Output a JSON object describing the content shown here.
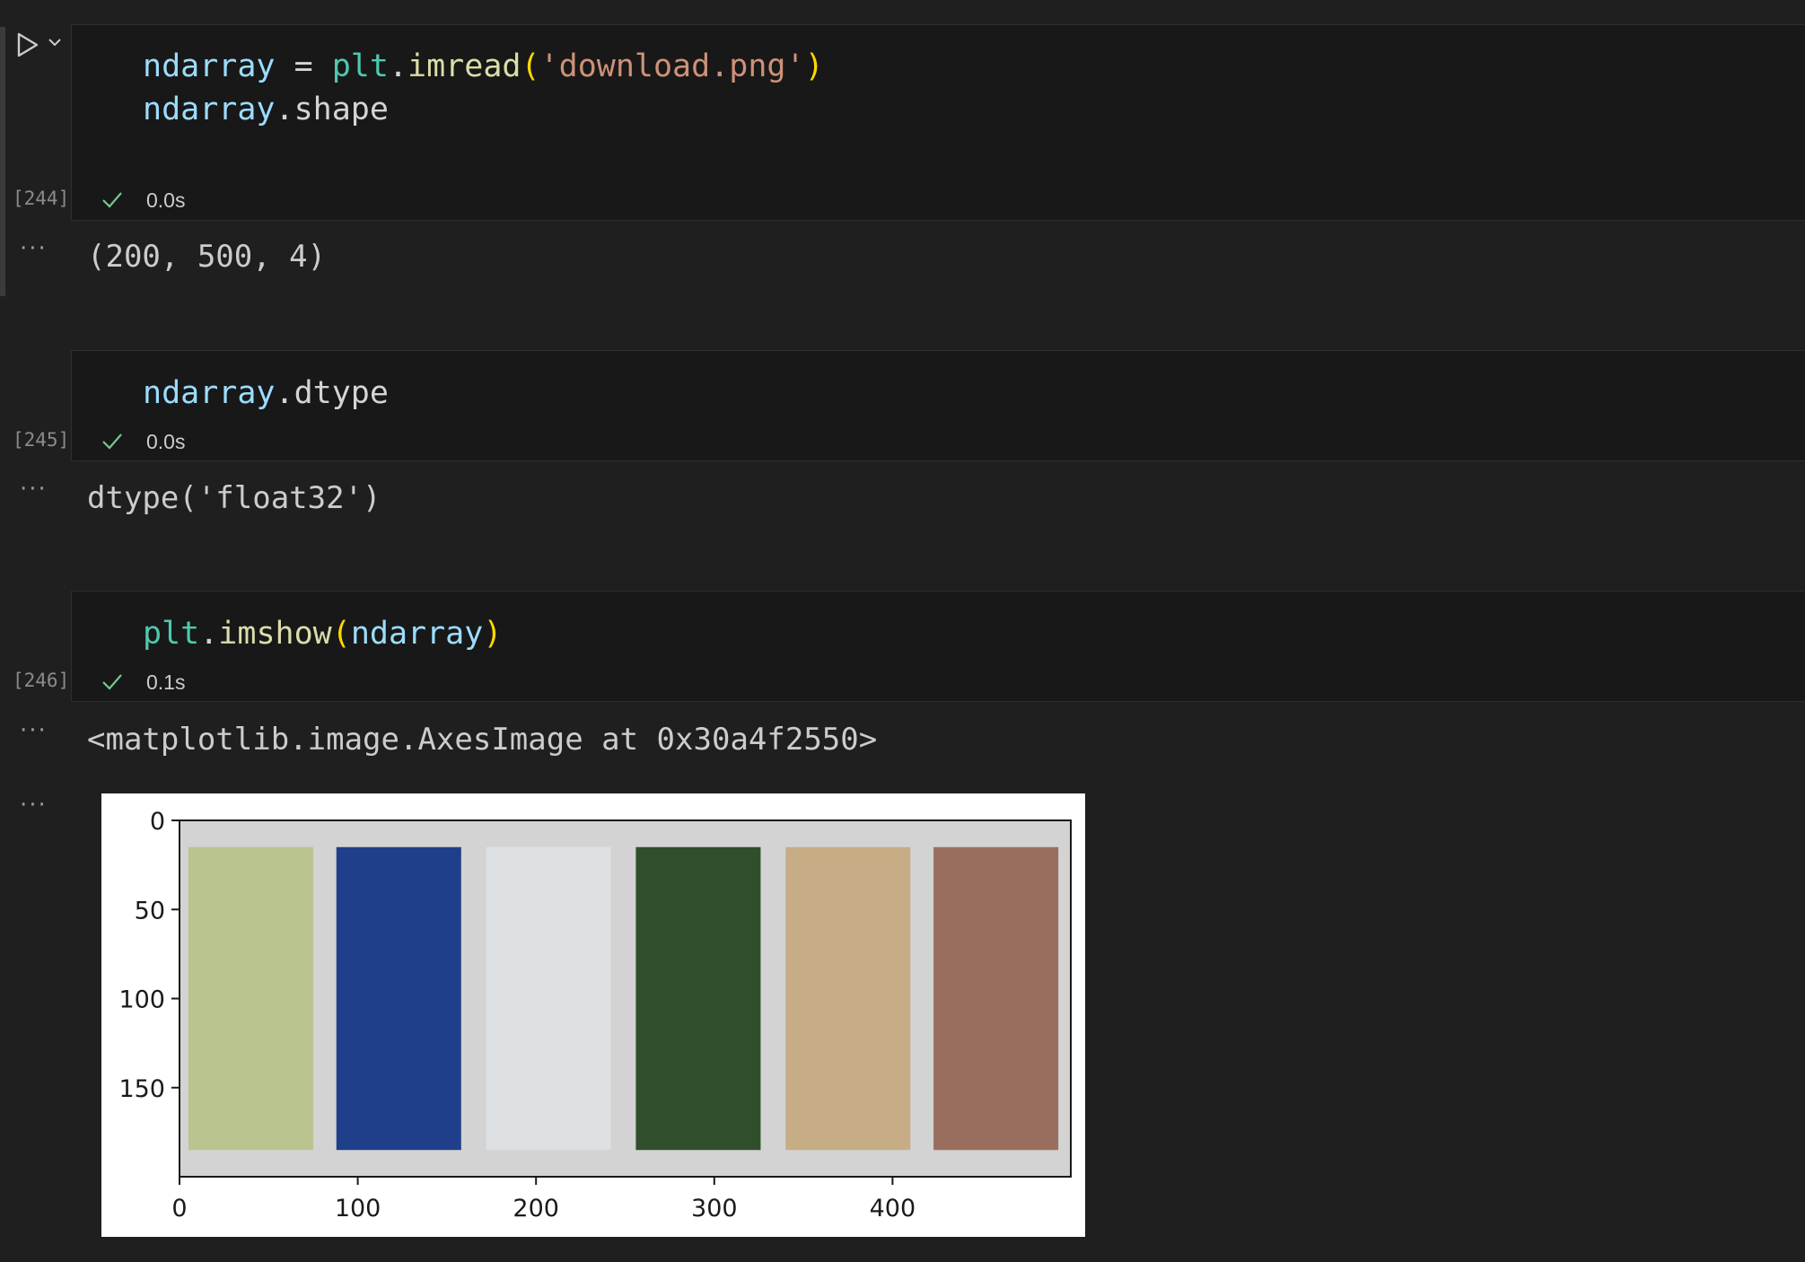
{
  "cells": [
    {
      "execution_count": "[244]",
      "time": "0.0s",
      "code": {
        "line1": {
          "a": "ndarray",
          "b": " = ",
          "c": "plt",
          "d": ".",
          "e": "imread",
          "f": "(",
          "g": "'download.png'",
          "h": ")"
        },
        "line2": {
          "a": "ndarray",
          "b": ".shape"
        }
      },
      "output": "(200, 500, 4)"
    },
    {
      "execution_count": "[245]",
      "time": "0.0s",
      "code": {
        "line1": {
          "a": "ndarray",
          "b": ".dtype"
        }
      },
      "output": "dtype('float32')"
    },
    {
      "execution_count": "[246]",
      "time": "0.1s",
      "code": {
        "line1": {
          "a": "plt",
          "b": ".",
          "c": "imshow",
          "d": "(",
          "e": "ndarray",
          "f": ")"
        }
      },
      "output": "<matplotlib.image.AxesImage at 0x30a4f2550>"
    }
  ],
  "output_toggle": "···",
  "icons": {
    "run": "play-icon",
    "run_menu": "chevron-down-icon",
    "success": "check-icon"
  },
  "colors": {
    "background": "#1f1f1f",
    "cell_background": "#181818",
    "check": "#73c991"
  },
  "chart_data": {
    "type": "image",
    "x_ticks": [
      0,
      100,
      200,
      300,
      400
    ],
    "y_ticks": [
      0,
      50,
      100,
      150
    ],
    "xlim": [
      0,
      500
    ],
    "ylim": [
      200,
      0
    ],
    "panels": [
      {
        "x": [
          5,
          75
        ],
        "y": [
          15,
          185
        ],
        "color": "#b9c48e"
      },
      {
        "x": [
          88,
          158
        ],
        "y": [
          15,
          185
        ],
        "color": "#1f3f8a"
      },
      {
        "x": [
          172,
          242
        ],
        "y": [
          15,
          185
        ],
        "color": "#dde1e4"
      },
      {
        "x": [
          256,
          326
        ],
        "y": [
          15,
          185
        ],
        "color": "#2f4f2a"
      },
      {
        "x": [
          340,
          410
        ],
        "y": [
          15,
          185
        ],
        "color": "#c6ad85"
      },
      {
        "x": [
          423,
          493
        ],
        "y": [
          15,
          185
        ],
        "color": "#9a6e5e"
      }
    ],
    "image_background": "#d3d3d3"
  }
}
